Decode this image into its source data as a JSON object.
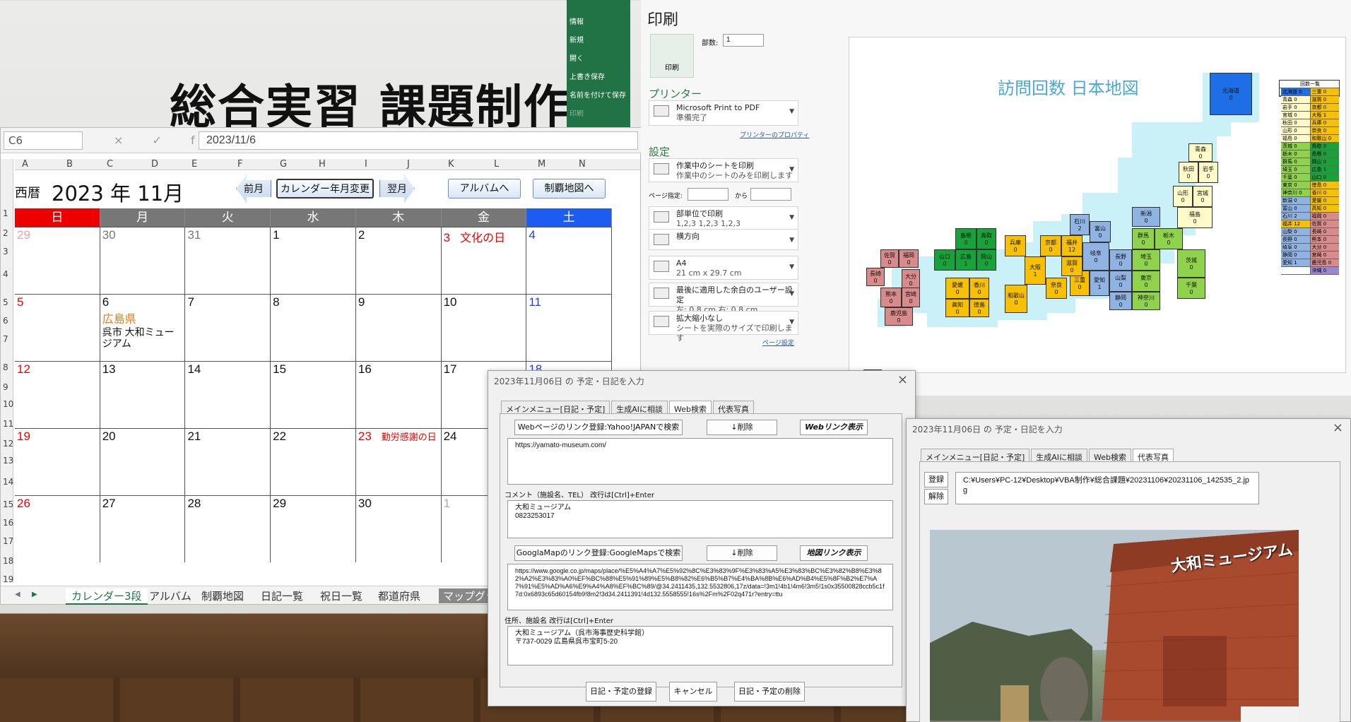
{
  "slide_title": "総合実習 課題制作",
  "excel": {
    "name_box": "C6",
    "formula_icons": "× ✓ fx",
    "formula_value": "2023/11/6",
    "columns": [
      "A",
      "B",
      "C",
      "D",
      "E",
      "F",
      "G",
      "H",
      "I",
      "J",
      "K",
      "L",
      "M",
      "N"
    ],
    "rows": [
      "1",
      "2",
      "3",
      "4",
      "5",
      "6",
      "7",
      "8",
      "9",
      "10",
      "11",
      "12",
      "13",
      "14",
      "15",
      "16",
      "17",
      "18",
      "19"
    ],
    "era": "西暦",
    "year_month": "2023 年  11月",
    "buttons": {
      "prev": "前月",
      "change": "カレンダー年月変更",
      "next": "翌月",
      "album": "アルバムへ",
      "map": "制覇地図へ"
    },
    "weekdays": [
      "日",
      "月",
      "火",
      "水",
      "木",
      "金",
      "土"
    ],
    "weeks": [
      [
        {
          "d": "29",
          "c": "#f2a0a0"
        },
        {
          "d": "30",
          "c": "#777"
        },
        {
          "d": "31",
          "c": "#777"
        },
        {
          "d": "1",
          "c": "#111"
        },
        {
          "d": "2",
          "c": "#111"
        },
        {
          "d": "3",
          "c": "#e00",
          "note": "文化の日",
          "nc": "#e00"
        },
        {
          "d": "4",
          "c": "#1f3fd0"
        }
      ],
      [
        {
          "d": "5",
          "c": "#e00"
        },
        {
          "d": "6",
          "c": "#111",
          "note": "広島県",
          "nc": "#e87a1a",
          "note2": "呉市 大和ミュー",
          "note3": "ジアム"
        },
        {
          "d": "7",
          "c": "#111"
        },
        {
          "d": "8",
          "c": "#111"
        },
        {
          "d": "9",
          "c": "#111"
        },
        {
          "d": "10",
          "c": "#111"
        },
        {
          "d": "11",
          "c": "#1f3fd0"
        }
      ],
      [
        {
          "d": "12",
          "c": "#e00"
        },
        {
          "d": "13",
          "c": "#111"
        },
        {
          "d": "14",
          "c": "#111"
        },
        {
          "d": "15",
          "c": "#111"
        },
        {
          "d": "16",
          "c": "#111"
        },
        {
          "d": "17",
          "c": "#111"
        },
        {
          "d": "18",
          "c": "#1f3fd0"
        }
      ],
      [
        {
          "d": "19",
          "c": "#e00"
        },
        {
          "d": "20",
          "c": "#111"
        },
        {
          "d": "21",
          "c": "#111"
        },
        {
          "d": "22",
          "c": "#111"
        },
        {
          "d": "23",
          "c": "#e00",
          "note": "勤労感謝の日",
          "nc": "#e00"
        },
        {
          "d": "24",
          "c": "#111"
        },
        {
          "d": "",
          "c": "#111"
        }
      ],
      [
        {
          "d": "26",
          "c": "#e00"
        },
        {
          "d": "27",
          "c": "#111"
        },
        {
          "d": "28",
          "c": "#111"
        },
        {
          "d": "29",
          "c": "#111"
        },
        {
          "d": "30",
          "c": "#111"
        },
        {
          "d": "1",
          "c": "#aaa"
        },
        {
          "d": "",
          "c": "#111"
        }
      ]
    ],
    "sheet_tabs": [
      "カレンダー3段",
      "アルバム",
      "制覇地図",
      "日記一覧",
      "祝日一覧",
      "都道府県",
      "マップグラフ"
    ]
  },
  "backstage": {
    "menu": [
      "情報",
      "新規",
      "開く",
      "上書き保存",
      "名前を付けて保存",
      "印刷"
    ]
  },
  "print": {
    "title": "印刷",
    "print_button": "印刷",
    "copies_label": "部数:",
    "copies": "1",
    "printer_label": "プリンター",
    "printer_name": "Microsoft Print to PDF",
    "printer_status": "準備完了",
    "printer_props": "プリンターのプロパティ",
    "settings_label": "設定",
    "settings": [
      {
        "main": "作業中のシートを印刷",
        "sub": "作業中のシートのみを印刷します"
      },
      {
        "main": "部単位で印刷",
        "sub": "1,2,3    1,2,3    1,2,3"
      },
      {
        "main": "横方向",
        "sub": ""
      },
      {
        "main": "A4",
        "sub": "21 cm x 29.7 cm"
      },
      {
        "main": "最後に適用した余白のユーザー設定",
        "sub": "左:  0.8 cm    右:  0.8 cm"
      },
      {
        "main": "拡大縮小なし",
        "sub": "シートを実際のサイズで印刷します"
      }
    ],
    "pages_label": "ページ指定:",
    "pages_to": "から",
    "page_setup": "ページ設定"
  },
  "map": {
    "title": "訪問回数 日本地図",
    "legend_title": "回数一覧",
    "legend_left": [
      "北海道 0",
      "青森 0",
      "岩手 0",
      "宮城 0",
      "秋田 0",
      "山形 0",
      "福島 0",
      "茨城 0",
      "栃木 0",
      "群馬 0",
      "埼玉 0",
      "千葉 0",
      "東京 0",
      "神奈川 0",
      "新潟 0",
      "富山 0",
      "石川 2",
      "福井 12",
      "山梨 0",
      "長野 0",
      "岐阜 0",
      "静岡 0",
      "愛知 1",
      ""
    ],
    "legend_right": [
      "三重 0",
      "滋賀 0",
      "京都 0",
      "大阪 1",
      "兵庫 0",
      "奈良 0",
      "和歌山 0",
      "鳥取 0",
      "島根 0",
      "岡山 0",
      "広島 1",
      "山口 0",
      "徳島 0",
      "香川 0",
      "愛媛 0",
      "高知 0",
      "福岡 0",
      "佐賀 0",
      "長崎 0",
      "熊本 0",
      "大分 0",
      "宮崎 0",
      "鹿児島 0",
      "沖縄 0"
    ],
    "prefs": [
      {
        "n": "北海道",
        "v": "0"
      },
      {
        "n": "青森",
        "v": "0"
      },
      {
        "n": "秋田",
        "v": "0"
      },
      {
        "n": "岩手",
        "v": "0"
      },
      {
        "n": "山形",
        "v": "0"
      },
      {
        "n": "宮城",
        "v": "0"
      },
      {
        "n": "福島",
        "v": "0"
      },
      {
        "n": "新潟",
        "v": "0"
      },
      {
        "n": "群馬",
        "v": "0"
      },
      {
        "n": "栃木",
        "v": "0"
      },
      {
        "n": "茨城",
        "v": "0"
      },
      {
        "n": "埼玉",
        "v": "0"
      },
      {
        "n": "千葉",
        "v": "0"
      },
      {
        "n": "東京",
        "v": "0"
      },
      {
        "n": "神奈川",
        "v": "0"
      },
      {
        "n": "山梨",
        "v": "0"
      },
      {
        "n": "長野",
        "v": "0"
      },
      {
        "n": "富山",
        "v": "0"
      },
      {
        "n": "石川",
        "v": "2"
      },
      {
        "n": "福井",
        "v": "12"
      },
      {
        "n": "岐阜",
        "v": "0"
      },
      {
        "n": "愛知",
        "v": "1"
      },
      {
        "n": "静岡",
        "v": "0"
      },
      {
        "n": "三重",
        "v": "0"
      },
      {
        "n": "滋賀",
        "v": "0"
      },
      {
        "n": "京都",
        "v": "0"
      },
      {
        "n": "大阪",
        "v": "1"
      },
      {
        "n": "兵庫",
        "v": "0"
      },
      {
        "n": "奈良",
        "v": "0"
      },
      {
        "n": "和歌山",
        "v": "0"
      },
      {
        "n": "鳥取",
        "v": "0"
      },
      {
        "n": "島根",
        "v": "0"
      },
      {
        "n": "岡山",
        "v": "0"
      },
      {
        "n": "広島",
        "v": "1"
      },
      {
        "n": "山口",
        "v": "0"
      },
      {
        "n": "香川",
        "v": "0"
      },
      {
        "n": "愛媛",
        "v": "0"
      },
      {
        "n": "徳島",
        "v": "0"
      },
      {
        "n": "高知",
        "v": "0"
      },
      {
        "n": "福岡",
        "v": "0"
      },
      {
        "n": "佐賀",
        "v": "0"
      },
      {
        "n": "長崎",
        "v": "0"
      },
      {
        "n": "大分",
        "v": "0"
      },
      {
        "n": "熊本",
        "v": "0"
      },
      {
        "n": "宮崎",
        "v": "0"
      },
      {
        "n": "鹿児島",
        "v": "0"
      },
      {
        "n": "沖縄",
        "v": ""
      }
    ]
  },
  "dialog1": {
    "title": "2023年11月06日 の 予定・日記を入力",
    "tabs": [
      "メインメニュー[日記・予定]",
      "生成AIに相談",
      "Web検索",
      "代表写真"
    ],
    "web_link_btn": "Webページのリンク登録:Yahoo!JAPANで検索",
    "delete_btn": "↓削除",
    "web_show_btn": "Webリンク表示",
    "web_url": "https://yamato-museum.com/",
    "comment_label": "コメント（施設名、TEL）  改行は[Ctrl]+Enter",
    "comment_line1": "大和ミュージアム",
    "comment_line2": "0823253017",
    "map_link_btn": "GooglaMapのリンク登録:GoogleMapsで検索",
    "delete_btn2": "↓削除",
    "map_show_btn": "地図リンク表示",
    "map_url": "https://www.google.co.jp/maps/place/%E5%A4%A7%E5%92%8C%E3%83%9F%E3%83%A5%E3%83%BC%E3%82%B8%E3%82%A2%E3%83%A0%EF%BC%88%E5%91%89%E5%B8%82%E6%B5%B7%E4%BA%8B%E6%AD%B4%E5%8F%B2%E7%A7%91%E5%AD%A6%E9%A4%A8%EF%BC%89/@34.2411435,132.5532806,17z/data=!3m1!4b1!4m6!3m5!1s0x35500828ccb5c1f7d:0x6893c65d60154fb9!8m2!3d34.2411391!4d132.5558555!16s%2Fm%2F02q471r?entry=ttu",
    "address_label": "住所、施設名  改行は[Ctrl]+Enter",
    "address_line1": "大和ミュージアム（呉市海事歴史科学館）",
    "address_line2": "〒737-0029 広島県呉市宝町5-20",
    "register_btn": "日記・予定の登録",
    "cancel_btn": "キャンセル",
    "delete_entry_btn": "日記・予定の削除"
  },
  "dialog2": {
    "title": "2023年11月06日 の 予定・日記を入力",
    "tabs": [
      "メインメニュー[日記・予定]",
      "生成AIに相談",
      "Web検索",
      "代表写真"
    ],
    "register_btn": "登録",
    "release_btn": "解除",
    "path": "C:¥Users¥PC-12¥Desktop¥VBA制作¥総合課題¥20231106¥20231106_142535_2.jpg",
    "photo_sign": "大和ミュージアム"
  }
}
